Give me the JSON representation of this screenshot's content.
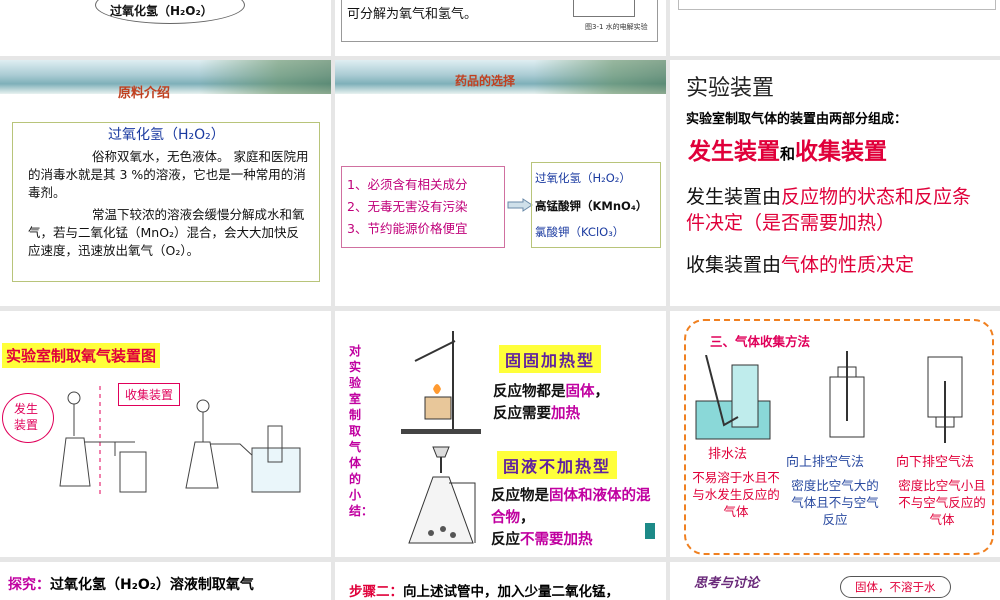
{
  "s1": {
    "formula": "过氧化氢（H₂O₂）"
  },
  "s2": {
    "text": "可分解为氧气和氢气。",
    "caption": "图3-1  水的电解实验"
  },
  "s4": {
    "header": "原料介绍",
    "box_title": "过氧化氢（H₂O₂）",
    "p1": "俗称双氧水，无色液体。 家庭和医院用的消毒水就是其 3 %的溶液，它也是一种常用的消毒剂。",
    "p2": "常温下较浓的溶液会缓慢分解成水和氧气，若与二氧化锰（MnO₂）混合，会大大加快反应速度，迅速放出氧气（O₂）。"
  },
  "s5": {
    "header": "药品的选择",
    "criteria": [
      "1、必须含有相关成分",
      "2、无毒无害没有污染",
      "3、节约能源价格便宜"
    ],
    "choices": [
      "过氧化氢（H₂O₂）",
      "高锰酸钾（KMnO₄）",
      "氯酸钾（KClO₃）"
    ]
  },
  "s6": {
    "title": "实验装置",
    "intro": "实验室制取气体的装置由两部分组成：",
    "big_a": "发生装置",
    "big_and": "和",
    "big_b": "收集装置",
    "l1a": "发生装置由",
    "l1b": "反应物的状态和反应条件决定（是否需要加热）",
    "l2a": "收集装置由",
    "l2b": "气体的性质决定"
  },
  "s7": {
    "title": "实验室制取氧气装置图",
    "label_gen": "发生装置",
    "label_col": "收集装置"
  },
  "s8": {
    "vertical": "对实验室制取气体的小结：",
    "type1": "固固加热型",
    "t1a": "反应物都是",
    "t1b": "固体",
    "t1c": "，",
    "t1d": "反应需要",
    "t1e": "加热",
    "type2": "固液不加热型",
    "t2a": "反应物是",
    "t2b": "固体和液体的混合物",
    "t2c": "，",
    "t2d": "反应",
    "t2e": "不需要加热"
  },
  "s9": {
    "title": "三、气体收集方法",
    "m1": "排水法",
    "m2": "向上排空气法",
    "m3": "向下排空气法",
    "d1": "不易溶于水且不与水发生反应的气体",
    "d2": "密度比空气大的气体且不与空气反应",
    "d3": "密度比空气小且不与空气反应的气体"
  },
  "s10": {
    "a": "探究：",
    "b": "过氧化氢（H₂O₂）溶液制取氧气"
  },
  "s11": {
    "a": "步骤二：",
    "b": "向上述试管中，加入少量二氧化锰，"
  },
  "s12": {
    "a": "思考与讨论",
    "b": "固体，不溶于水"
  },
  "colors": {
    "red": "#e0003a",
    "magenta": "#c000a0",
    "yellow": "#ffff3a",
    "blue": "#2a4aa0"
  }
}
